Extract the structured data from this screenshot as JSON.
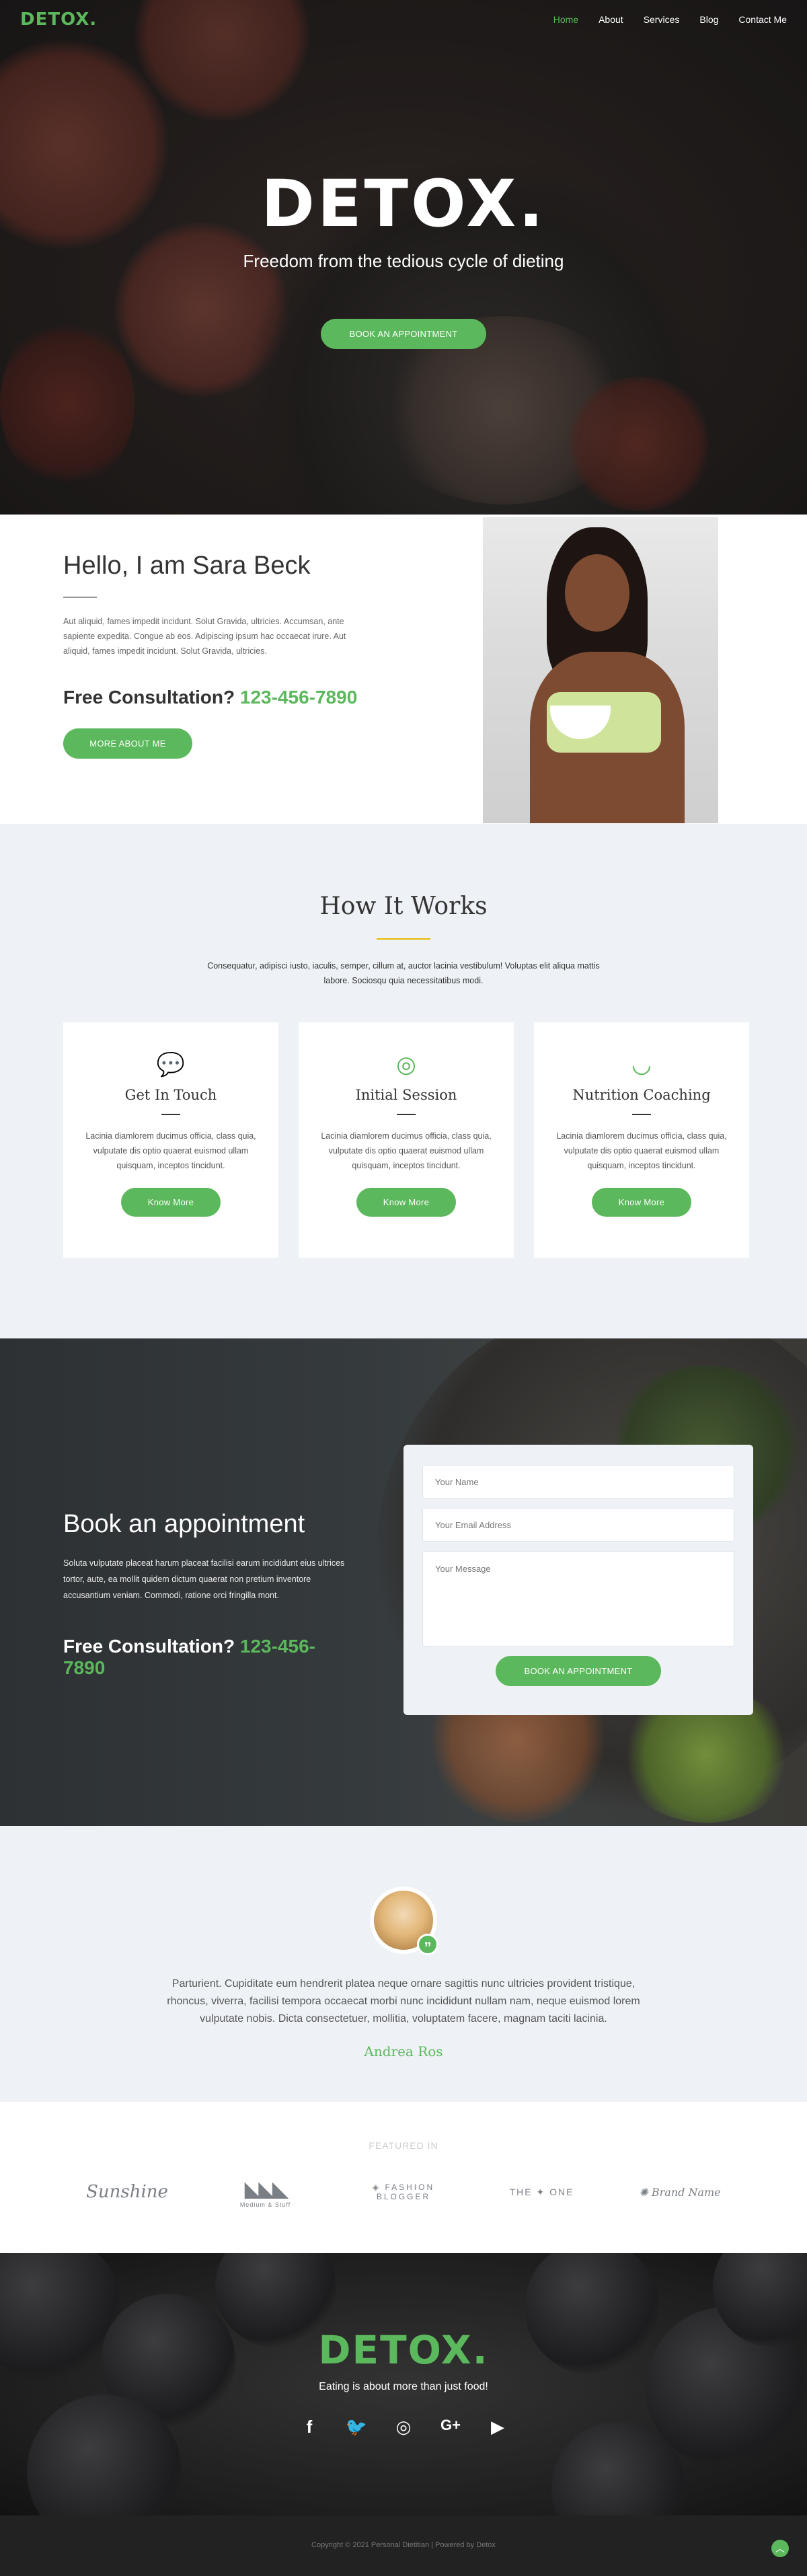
{
  "nav": {
    "logo": "DETOX.",
    "links": [
      "Home",
      "About",
      "Services",
      "Blog",
      "Contact Me"
    ]
  },
  "hero": {
    "logo": "DETOX.",
    "tagline": "Freedom from the tedious cycle of dieting",
    "button": "BOOK AN APPOINTMENT"
  },
  "about": {
    "title": "Hello, I am Sara Beck",
    "text": "Aut aliquid, fames impedit incidunt. Solut Gravida, ultricies. Accumsan, ante sapiente expedita. Congue ab eos. Adipiscing ipsum hac occaecat irure. Aut aliquid, fames impedit incidunt. Solut Gravida, ultricies.",
    "consult_label": "Free Consultation?",
    "phone": "123-456-7890",
    "button": "MORE ABOUT ME"
  },
  "how": {
    "title": "How It Works",
    "intro": "Consequatur, adipisci iusto, iaculis, semper, cillum at, auctor lacinia vestibulum! Voluptas elit aliqua mattis labore. Sociosqu quia necessitatibus modi.",
    "cards": [
      {
        "icon": "chat-icon",
        "title": "Get In Touch",
        "text": "Lacinia diamlorem ducimus officia, class quia, vulputate dis optio quaerat euismod ullam quisquam, inceptos tincidunt.",
        "button": "Know More"
      },
      {
        "icon": "globe-icon",
        "title": "Initial Session",
        "text": "Lacinia diamlorem ducimus officia, class quia, vulputate dis optio quaerat euismod ullam quisquam, inceptos tincidunt.",
        "button": "Know More"
      },
      {
        "icon": "bowl-icon",
        "title": "Nutrition Coaching",
        "text": "Lacinia diamlorem ducimus officia, class quia, vulputate dis optio quaerat euismod ullam quisquam, inceptos tincidunt.",
        "button": "Know More"
      }
    ]
  },
  "booking": {
    "title": "Book an appointment",
    "text": "Soluta vulputate placeat harum placeat facilisi earum incididunt eius ultrices tortor, aute, ea mollit quidem dictum quaerat non pretium inventore accusantium veniam. Commodi, ratione orci fringilla mont.",
    "consult_label": "Free Consultation?",
    "phone": "123-456-7890",
    "form": {
      "name_placeholder": "Your Name",
      "email_placeholder": "Your Email Address",
      "message_placeholder": "Your Message",
      "button": "BOOK AN APPOINTMENT"
    }
  },
  "testimonial": {
    "quote": "Parturient. Cupiditate eum hendrerit platea neque ornare sagittis nunc ultricies provident tristique, rhoncus, viverra, facilisi tempora occaecat morbi nunc incididunt nullam nam, neque euismod lorem vulputate nobis. Dicta consectetuer, mollitia, voluptatem facere, magnam taciti lacinia.",
    "name": "Andrea Ros"
  },
  "featured": {
    "label": "FEATURED IN"
  },
  "footer": {
    "logo": "DETOX.",
    "tagline": "Eating is about more than just food!",
    "socials": [
      "facebook-icon",
      "twitter-icon",
      "instagram-icon",
      "google-plus-icon",
      "youtube-icon"
    ],
    "copyright": "Copyright © 2021 Personal Dietitian | Powered by Detox"
  },
  "colors": {
    "accent": "#5cb85c",
    "section_bg": "#eef2f6",
    "divider_yellow": "#e6b800"
  }
}
